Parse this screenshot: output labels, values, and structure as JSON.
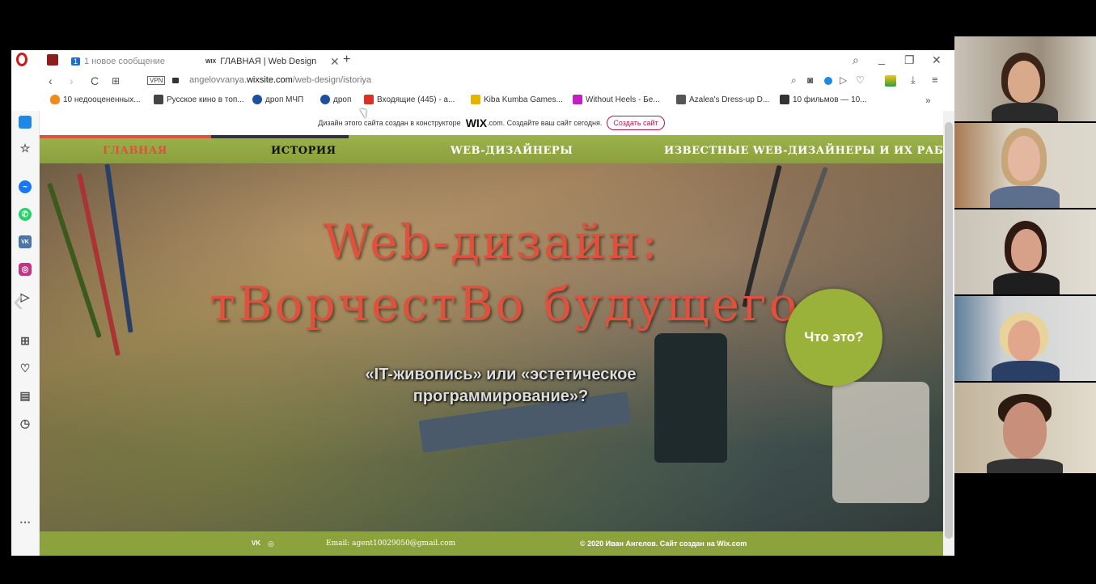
{
  "browser": {
    "tabs": [
      {
        "label": "1 новое сообщение",
        "badge": "1"
      },
      {
        "label": "ГЛАВНАЯ | Web Design"
      }
    ],
    "new_tab": "+",
    "address": {
      "host_prefix": "angelovvanya.",
      "host": "wixsite.com",
      "path": "/web-design/istoriya",
      "vpn": "VPN"
    },
    "bookmarks": [
      "10 недооцененных...",
      "Русское кино в топ...",
      "дроп МЧП",
      "дроп",
      "Входящие (445) - а...",
      "Kiba Kumba Games...",
      "Without Heels - Бе...",
      "Azalea's Dress-up D...",
      "10 фильмов — 10..."
    ],
    "more": "»"
  },
  "page": {
    "wix_banner": {
      "text_before": "Дизайн этого сайта создан в конструкторе",
      "logo": "WIX",
      "text_after": ".com. Создайте ваш сайт сегодня.",
      "button": "Создать сайт"
    },
    "nav": [
      "ГЛАВНАЯ",
      "ИСТОРИЯ",
      "WEB-ДИЗАЙНЕРЫ",
      "ИЗВЕСТНЫЕ WEB-ДИЗАЙНЕРЫ И ИХ РАБОТЫ"
    ],
    "hero": {
      "title_line1": "Web-дизайн:",
      "title_line2": "тВорчестВо будущего",
      "subtitle": "«IT-живопись» или «эстетическое программирование»?",
      "cta": "Что это?"
    },
    "footer": {
      "email": "Email: agent10029050@gmail.com",
      "copyright": "© 2020 Иван Ангелов. Сайт создан на Wix.com"
    }
  },
  "colors": {
    "nav_green": "#9cb24a",
    "title_red": "#e0503c",
    "cta_green": "#9bb23a",
    "opera_red": "#cc1b1b"
  }
}
